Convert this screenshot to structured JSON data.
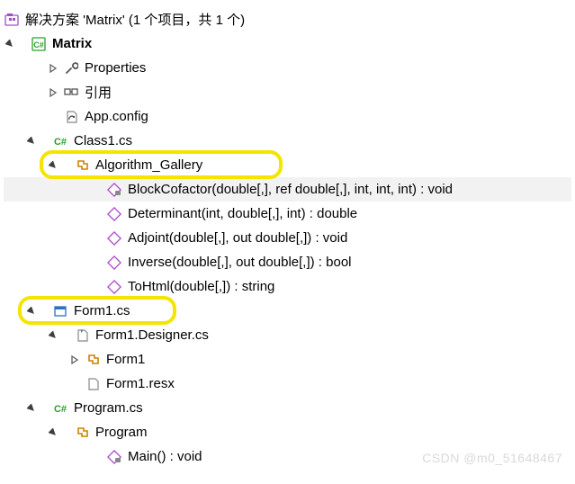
{
  "solution": {
    "title_prefix": "解决方案",
    "name": "Matrix",
    "count_text": "(1 个项目，共 1 个)"
  },
  "project": {
    "name": "Matrix"
  },
  "nodes": {
    "properties": "Properties",
    "references": "引用",
    "appconfig": "App.config",
    "class1": "Class1.cs",
    "algGallery": "Algorithm_Gallery",
    "m_block": "BlockCofactor(double[,], ref double[,], int, int, int) : void",
    "m_det": "Determinant(int, double[,], int) : double",
    "m_adj": "Adjoint(double[,], out double[,]) : void",
    "m_inv": "Inverse(double[,], out double[,]) : bool",
    "m_html": "ToHtml(double[,]) : string",
    "form1": "Form1.cs",
    "form1designer": "Form1.Designer.cs",
    "form1class": "Form1",
    "form1resx": "Form1.resx",
    "programcs": "Program.cs",
    "programclass": "Program",
    "m_main": "Main() : void"
  },
  "watermark": "CSDN @m0_51648467"
}
